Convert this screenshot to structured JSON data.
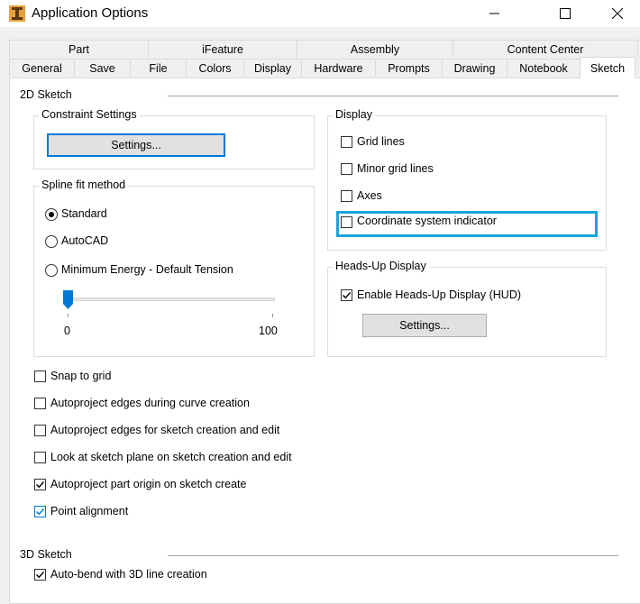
{
  "window": {
    "title": "Application Options",
    "minimize_glyph": "—",
    "maximize_glyph": "☐",
    "close_glyph": "✕"
  },
  "tabs_row1": [
    {
      "label": "Part"
    },
    {
      "label": "iFeature"
    },
    {
      "label": "Assembly"
    },
    {
      "label": "Content Center"
    }
  ],
  "tabs_row2": [
    {
      "label": "General"
    },
    {
      "label": "Save"
    },
    {
      "label": "File"
    },
    {
      "label": "Colors"
    },
    {
      "label": "Display"
    },
    {
      "label": "Hardware"
    },
    {
      "label": "Prompts"
    },
    {
      "label": "Drawing"
    },
    {
      "label": "Notebook"
    },
    {
      "label": "Sketch",
      "active": true
    }
  ],
  "sketch2d": {
    "title": "2D Sketch",
    "constraint_settings": {
      "title": "Constraint Settings",
      "button": "Settings..."
    },
    "spline": {
      "title": "Spline fit method",
      "options": [
        {
          "label": "Standard",
          "selected": true
        },
        {
          "label": "AutoCAD",
          "selected": false
        },
        {
          "label": "Minimum Energy - Default Tension",
          "selected": false
        }
      ],
      "slider_min": "0",
      "slider_max": "100",
      "slider_value": 0
    },
    "display": {
      "title": "Display",
      "options": [
        {
          "label": "Grid lines",
          "checked": false
        },
        {
          "label": "Minor grid lines",
          "checked": false
        },
        {
          "label": "Axes",
          "checked": false
        },
        {
          "label": "Coordinate system indicator",
          "checked": false
        }
      ]
    },
    "hud": {
      "title": "Heads-Up Display",
      "enable_label": "Enable Heads-Up Display (HUD)",
      "enable_checked": true,
      "button": "Settings..."
    },
    "options": [
      {
        "label": "Snap to grid",
        "checked": false
      },
      {
        "label": "Autoproject edges during curve creation",
        "checked": false
      },
      {
        "label": "Autoproject edges for sketch creation and edit",
        "checked": false
      },
      {
        "label": "Look at sketch plane on sketch creation and edit",
        "checked": false
      },
      {
        "label": "Autoproject part origin on sketch create",
        "checked": true
      },
      {
        "label": "Point alignment",
        "checked": true
      }
    ]
  },
  "sketch3d": {
    "title": "3D Sketch",
    "options": [
      {
        "label": "Auto-bend with 3D line creation",
        "checked": true
      }
    ]
  },
  "colors": {
    "accent": "#0078d7",
    "highlight": "#1aa3d9",
    "app_icon": "#e8a13a"
  }
}
